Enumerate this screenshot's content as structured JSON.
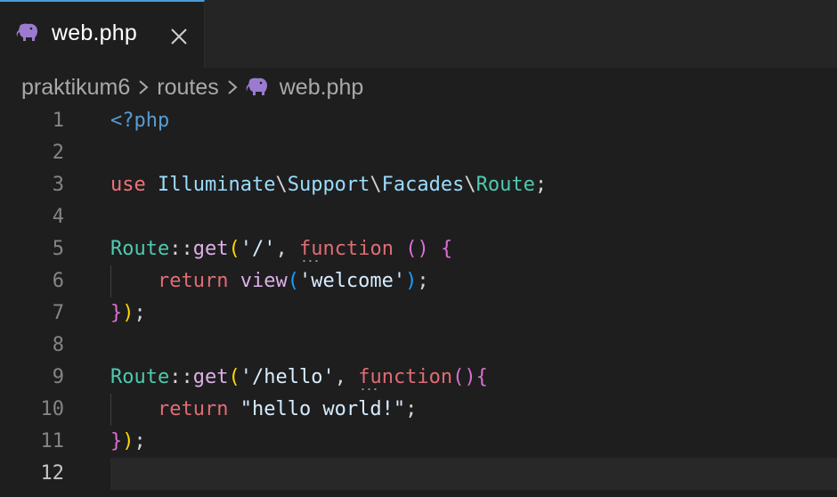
{
  "tab": {
    "label": "web.php",
    "icon": "php-elephant-icon",
    "close_icon": "close-icon"
  },
  "breadcrumb": {
    "items": [
      "praktikum6",
      "routes",
      "web.php"
    ]
  },
  "editor": {
    "current_line": 12,
    "lines": [
      {
        "num": "1",
        "tokens": [
          [
            "tk-tag",
            "<?php"
          ]
        ]
      },
      {
        "num": "2",
        "tokens": []
      },
      {
        "num": "3",
        "tokens": [
          [
            "tk-kw",
            "use"
          ],
          [
            "tk-plain",
            " "
          ],
          [
            "tk-ns",
            "Illuminate"
          ],
          [
            "tk-plain",
            "\\"
          ],
          [
            "tk-ns",
            "Support"
          ],
          [
            "tk-plain",
            "\\"
          ],
          [
            "tk-ns",
            "Facades"
          ],
          [
            "tk-plain",
            "\\"
          ],
          [
            "tk-cls",
            "Route"
          ],
          [
            "tk-plain",
            ";"
          ]
        ]
      },
      {
        "num": "4",
        "tokens": []
      },
      {
        "num": "5",
        "tokens": [
          [
            "tk-cls",
            "Route"
          ],
          [
            "tk-plain",
            "::"
          ],
          [
            "tk-fn",
            "get"
          ],
          [
            "tk-p1",
            "("
          ],
          [
            "tk-str",
            "'/'"
          ],
          [
            "tk-plain",
            ", "
          ],
          [
            "tk-kw2 squiggle",
            "function"
          ],
          [
            "tk-plain",
            " "
          ],
          [
            "tk-p2",
            "()"
          ],
          [
            "tk-plain",
            " "
          ],
          [
            "tk-p2",
            "{"
          ]
        ]
      },
      {
        "num": "6",
        "tokens": [
          [
            "tk-plain",
            "    "
          ],
          [
            "tk-kw2",
            "return"
          ],
          [
            "tk-plain",
            " "
          ],
          [
            "tk-fn",
            "view"
          ],
          [
            "tk-p3",
            "("
          ],
          [
            "tk-str",
            "'welcome'"
          ],
          [
            "tk-p3",
            ")"
          ],
          [
            "tk-plain",
            ";"
          ]
        ]
      },
      {
        "num": "7",
        "tokens": [
          [
            "tk-p2",
            "}"
          ],
          [
            "tk-p1",
            ")"
          ],
          [
            "tk-plain",
            ";"
          ]
        ]
      },
      {
        "num": "8",
        "tokens": []
      },
      {
        "num": "9",
        "tokens": [
          [
            "tk-cls",
            "Route"
          ],
          [
            "tk-plain",
            "::"
          ],
          [
            "tk-fn",
            "get"
          ],
          [
            "tk-p1",
            "("
          ],
          [
            "tk-str",
            "'/hello'"
          ],
          [
            "tk-plain",
            ", "
          ],
          [
            "tk-kw2 squiggle",
            "function"
          ],
          [
            "tk-p2",
            "(){"
          ]
        ]
      },
      {
        "num": "10",
        "tokens": [
          [
            "tk-plain",
            "    "
          ],
          [
            "tk-kw2",
            "return"
          ],
          [
            "tk-plain",
            " "
          ],
          [
            "tk-str",
            "\"hello world!\""
          ],
          [
            "tk-plain",
            ";"
          ]
        ]
      },
      {
        "num": "11",
        "tokens": [
          [
            "tk-p2",
            "}"
          ],
          [
            "tk-p1",
            ")"
          ],
          [
            "tk-plain",
            ";"
          ]
        ]
      },
      {
        "num": "12",
        "tokens": []
      }
    ]
  },
  "colors": {
    "background": "#1e1e1e",
    "tab_accent": "#4b9bd8",
    "php_icon": "#9b7bd0"
  }
}
